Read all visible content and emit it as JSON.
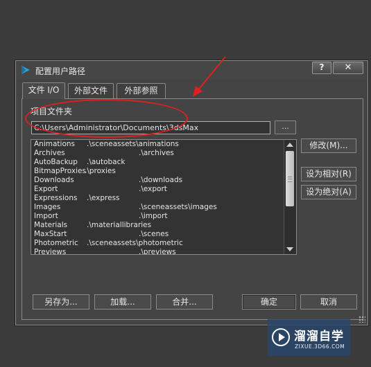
{
  "window": {
    "title": "配置用户路径",
    "help_label": "?",
    "close_label": "✕"
  },
  "tabs": [
    {
      "label": "文件 I/O",
      "active": true
    },
    {
      "label": "外部文件",
      "active": false
    },
    {
      "label": "外部参照",
      "active": false
    }
  ],
  "project_folder": {
    "label": "项目文件夹",
    "path": "C:\\Users\\Administrator\\Documents\\3dsMax",
    "browse_label": "..."
  },
  "path_list": [
    {
      "name": "Animations",
      "path": ".\\sceneassets\\animations"
    },
    {
      "name": "Archives",
      "path": ".\\archives"
    },
    {
      "name": "AutoBackup",
      "path": ".\\autoback"
    },
    {
      "name": "BitmapProxies",
      "path": ".\\proxies"
    },
    {
      "name": "Downloads",
      "path": ".\\downloads"
    },
    {
      "name": "Export",
      "path": ".\\export"
    },
    {
      "name": "Expressions",
      "path": ".\\express"
    },
    {
      "name": "Images",
      "path": ".\\sceneassets\\images"
    },
    {
      "name": "Import",
      "path": ".\\import"
    },
    {
      "name": "Materials",
      "path": ".\\materiallibraries"
    },
    {
      "name": "MaxStart",
      "path": ".\\scenes"
    },
    {
      "name": "Photometric",
      "path": ".\\sceneassets\\photometric"
    },
    {
      "name": "Previews",
      "path": ".\\previews"
    }
  ],
  "side_buttons": {
    "modify": "修改(M)...",
    "make_relative": "设为相对(R)",
    "make_absolute": "设为绝对(A)"
  },
  "bottom_buttons": {
    "save_as": "另存为...",
    "load": "加载...",
    "merge": "合并...",
    "ok": "确定",
    "cancel": "取消"
  },
  "annotation": {
    "color": "#e02020"
  },
  "watermark": {
    "brand": "溜溜自学",
    "url": "ZIXUE.3D66.COM"
  },
  "colors": {
    "background": "#3b3b3b",
    "dialog": "#444444",
    "field": "#333333",
    "watermark_bg": "#28466e"
  }
}
